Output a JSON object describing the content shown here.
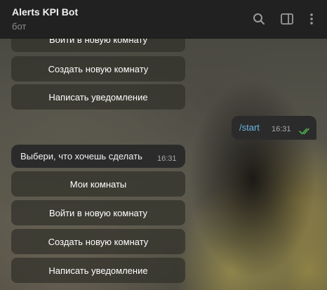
{
  "header": {
    "title": "Alerts KPI Bot",
    "subtitle": "бот",
    "icons": [
      "search-icon",
      "sidebar-toggle-icon",
      "more-vertical-icon"
    ]
  },
  "top_keyboard": {
    "buttons": [
      "Войти в новую комнату",
      "Создать новую комнату",
      "Написать уведомление"
    ]
  },
  "outgoing_message": {
    "text": "/start",
    "time": "16:31",
    "status_icon": "double-check-icon"
  },
  "incoming_message": {
    "text": "Выбери, что хочешь сделать",
    "time": "16:31"
  },
  "bottom_keyboard": {
    "buttons": [
      "Мои комнаты",
      "Войти в новую комнату",
      "Создать новую комнату",
      "Написать уведомление"
    ]
  },
  "colors": {
    "header_bg": "#212121",
    "bubble_bg": "#2b2b2b",
    "command_link": "#6ab7e0",
    "read_checks": "#4fae4e"
  }
}
